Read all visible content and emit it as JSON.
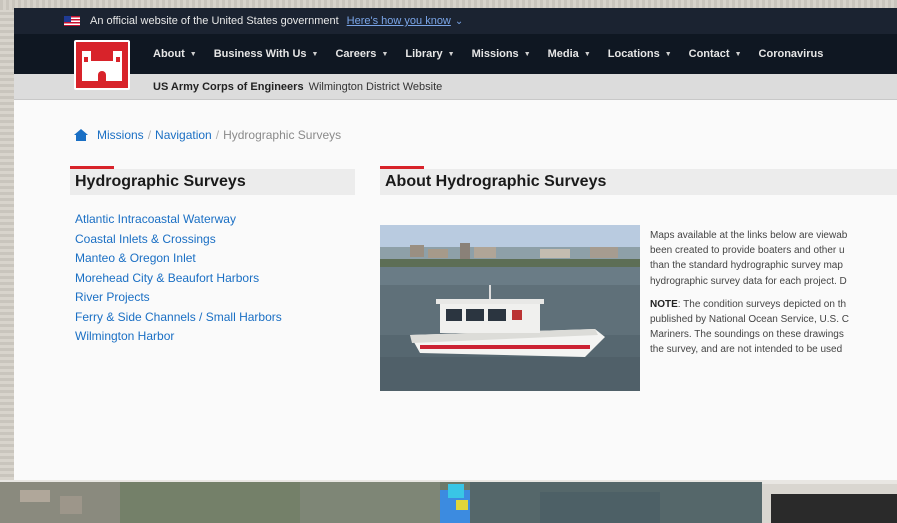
{
  "gov_banner": {
    "text": "An official website of the United States government",
    "link": "Here's how you know",
    "chevron": "⌄"
  },
  "nav": {
    "items": [
      {
        "label": "About",
        "caret": true
      },
      {
        "label": "Business With Us",
        "caret": true
      },
      {
        "label": "Careers",
        "caret": true
      },
      {
        "label": "Library",
        "caret": true
      },
      {
        "label": "Missions",
        "caret": true
      },
      {
        "label": "Media",
        "caret": true
      },
      {
        "label": "Locations",
        "caret": true
      },
      {
        "label": "Contact",
        "caret": true
      },
      {
        "label": "Coronavirus",
        "caret": false
      }
    ]
  },
  "site_bar": {
    "org": "US Army Corps of Engineers",
    "district": "Wilmington District Website"
  },
  "breadcrumb": {
    "missions": "Missions",
    "sep1": "/",
    "navigation": "Navigation",
    "sep2": "/",
    "current": "Hydrographic Surveys"
  },
  "sidebar": {
    "title": "Hydrographic Surveys",
    "links": [
      "Atlantic Intracoastal Waterway",
      "Coastal Inlets & Crossings",
      "Manteo & Oregon Inlet",
      "Morehead City & Beaufort Harbors",
      "River Projects",
      "Ferry & Side Channels / Small Harbors",
      "Wilmington Harbor"
    ]
  },
  "main": {
    "title": "About Hydrographic Surveys",
    "paragraph1": [
      "Maps available at the links below are viewab",
      "been created to provide boaters and other u",
      "than the standard hydrographic survey map",
      "hydrographic survey data for each project. D"
    ],
    "note_label": "NOTE",
    "paragraph2_first": ": The condition surveys depicted on th",
    "paragraph2": [
      "published by National Ocean Service, U.S. C",
      "Mariners. The soundings on these drawings",
      "the survey, and are not intended to be used"
    ]
  },
  "colors": {
    "accent_red": "#d8232a",
    "link_blue": "#1a6fc4",
    "nav_dark": "#0f1722"
  }
}
